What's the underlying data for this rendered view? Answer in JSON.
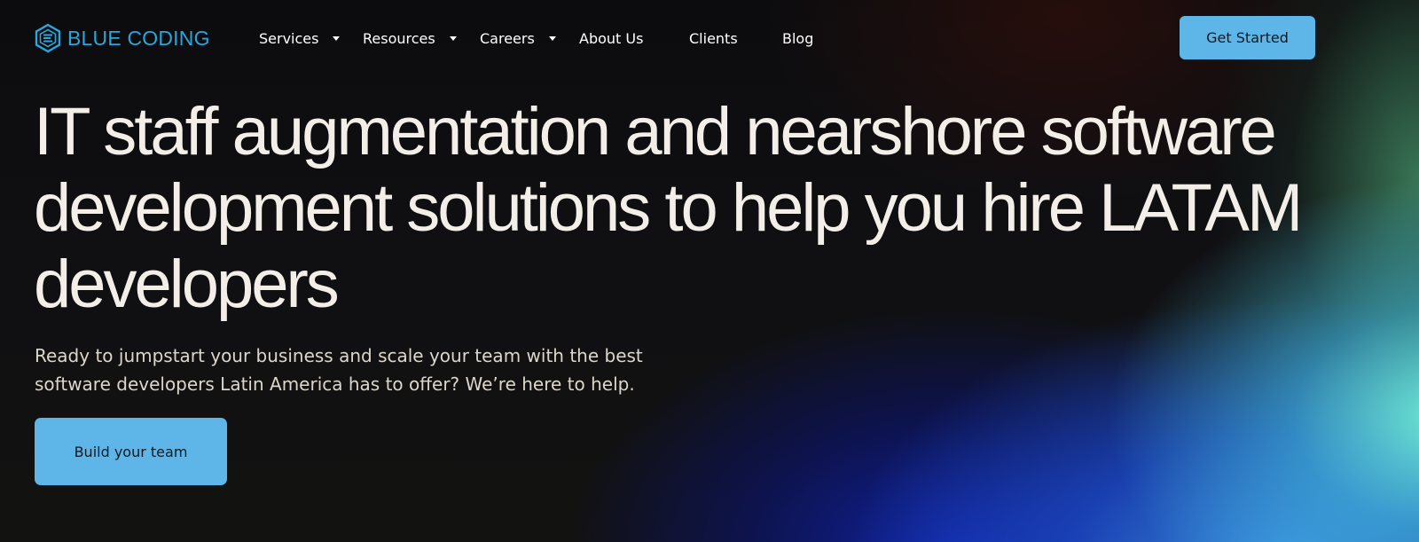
{
  "brand": {
    "name": "BLUE CODING",
    "logo_icon": "hexagon-logo-icon",
    "color": "#2aa6dc"
  },
  "nav": {
    "items": [
      {
        "label": "Services",
        "has_dropdown": true
      },
      {
        "label": "Resources",
        "has_dropdown": true
      },
      {
        "label": "Careers",
        "has_dropdown": true
      },
      {
        "label": "About Us",
        "has_dropdown": false
      },
      {
        "label": "Clients",
        "has_dropdown": false
      },
      {
        "label": "Blog",
        "has_dropdown": false
      }
    ],
    "cta_label": "Get Started"
  },
  "hero": {
    "title_lines": [
      "IT staff augmentation and nearshore software",
      "development solutions to help you hire LATAM",
      "developers"
    ],
    "subtitle_lines": [
      "Ready to jumpstart your business and scale your team with the best",
      "software developers Latin America has to offer? We’re here to help."
    ],
    "cta_label": "Build your team"
  },
  "colors": {
    "accent": "#5db5e8",
    "background": "#0b0b0d",
    "text": "#f3efe8"
  }
}
